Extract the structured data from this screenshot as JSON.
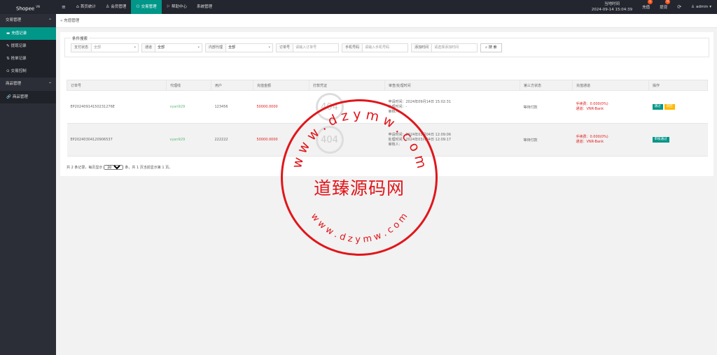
{
  "topbar": {
    "logo": "Shopee",
    "logo_sup": "VN",
    "nav_toggle": "≡",
    "nav": [
      {
        "icon": "⌂",
        "label": "首页统计"
      },
      {
        "icon": "♙",
        "label": "会员管理"
      },
      {
        "icon": "⚇",
        "label": "交易管理"
      },
      {
        "icon": "⚐",
        "label": "帮助中心"
      },
      {
        "icon": "",
        "label": "系统管理"
      }
    ],
    "datetime_label": "当地时间",
    "datetime_value": "2024-09-14 15:04:39",
    "recharge_label": "充值",
    "recharge_badge": "1",
    "withdraw_label": "提现",
    "withdraw_badge": "0",
    "refresh_icon": "⟳",
    "user_label": "admin",
    "user_caret": "▾"
  },
  "sidebar": {
    "group1": "交易管理",
    "items1": [
      {
        "icon": "▬",
        "label": "充值记录"
      },
      {
        "icon": "✎",
        "label": "提现记录"
      },
      {
        "icon": "⇅",
        "label": "抢单记录"
      },
      {
        "icon": "⊙",
        "label": "交易控制"
      }
    ],
    "group2": "商品管理",
    "items2": [
      {
        "icon": "🔗",
        "label": "商品管理"
      }
    ],
    "chevron": "⌃"
  },
  "breadcrumb": {
    "prefix": "«",
    "label": "充值管理"
  },
  "search": {
    "title": "条件搜索",
    "pay_status_label": "支付状态",
    "pay_status_value": "全部",
    "channel_label": "通道",
    "channel_value": "全部",
    "agent_label": "内部代理",
    "agent_value": "全部",
    "order_label": "订单号",
    "order_placeholder": "请输入订单号",
    "phone_label": "手机号码",
    "phone_placeholder": "请输入手机号码",
    "time_label": "添加时间",
    "time_placeholder": "请选择添加时间",
    "button": "搜 索",
    "caret": "▾"
  },
  "table": {
    "headers": [
      "订单号",
      "代理线",
      "用户",
      "充值金额",
      "打款凭证",
      "审查/处理时间",
      "第三方状态",
      "充值通道",
      "操作"
    ],
    "rows": [
      {
        "order": "EP20240914150231276E",
        "agent": "vyan929",
        "user": "123456",
        "amount": "50000.0000",
        "proof": "404",
        "apply": "申请时间：2024年09月14日 15:02:31",
        "process": "处理时间：-",
        "reviewer": "审核人:",
        "third_status": "等待付款",
        "fee": "手续费：0.000(0%)",
        "channel": "通道：VNR-Bank",
        "btn1": "通过",
        "btn2": "驳回"
      },
      {
        "order": "EP20240304120906537",
        "agent": "vyan929",
        "user": "222222",
        "amount": "50000.0000",
        "proof": "404",
        "apply": "申请时间：2024年03月04日 12:09:06",
        "process": "处理时间：2024年03月04日 12:09:17",
        "reviewer": "审核人:",
        "third_status": "等待付款",
        "fee": "手续费：0.000(0%)",
        "channel": "通道：VNR-Bank",
        "btn1": "审核通过"
      }
    ]
  },
  "pager": {
    "prefix": "共 2 条记录，每页显示",
    "page_size": "20",
    "suffix": "条，共 1 页当前显示第 1 页。"
  },
  "watermark": {
    "center": "道臻源码网",
    "ring_top": "w w w . d z y m w . c o m",
    "ring_bottom": "w w w . d z y m w . c o m"
  }
}
